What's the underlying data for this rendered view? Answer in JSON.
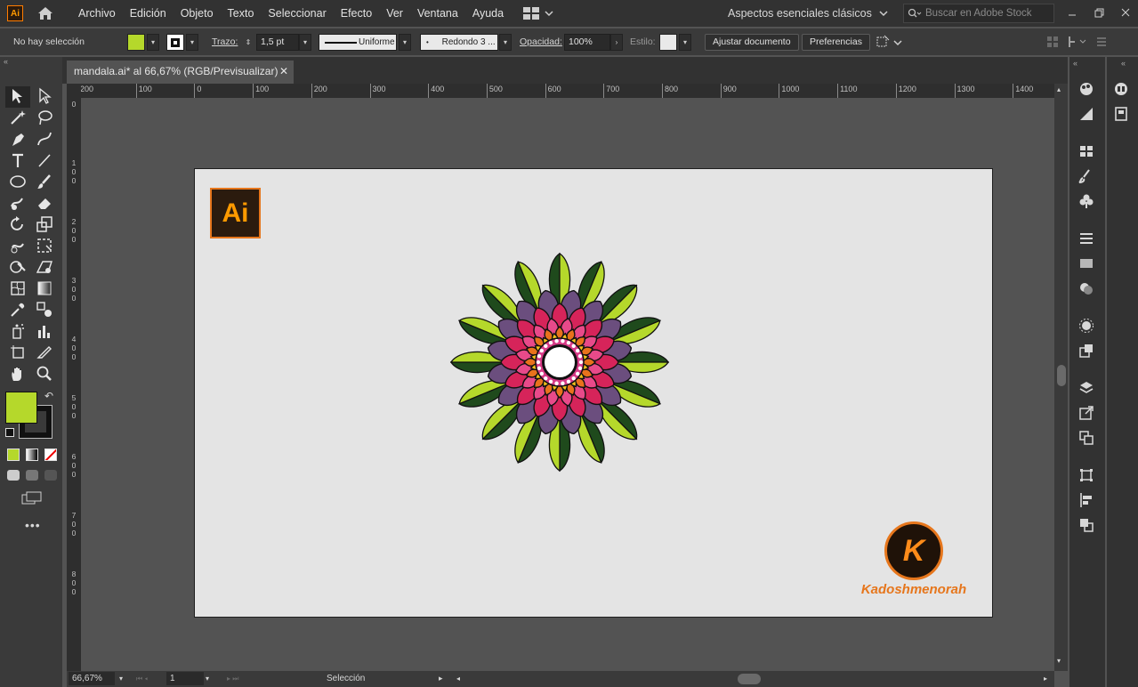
{
  "app": {
    "badge": "Ai"
  },
  "menu": [
    "Archivo",
    "Edición",
    "Objeto",
    "Texto",
    "Seleccionar",
    "Efecto",
    "Ver",
    "Ventana",
    "Ayuda"
  ],
  "workspace": {
    "label": "Aspectos esenciales clásicos"
  },
  "stock_search": {
    "placeholder": "Buscar en Adobe Stock"
  },
  "control": {
    "selection": "No hay selección",
    "fill_color": "#b5d82b",
    "stroke_label": "Trazo:",
    "stroke_weight": "1,5 pt",
    "profile": "Uniforme",
    "brush": "Redondo 3 ...",
    "opacity_label": "Opacidad:",
    "opacity": "100%",
    "style_label": "Estilo:",
    "fit_button": "Ajustar documento",
    "prefs_button": "Preferencias"
  },
  "document": {
    "tab_title": "mandala.ai* al 66,67% (RGB/Previsualizar)",
    "close": "✕"
  },
  "ruler_top": [
    "200",
    "100",
    "0",
    "100",
    "200",
    "300",
    "400",
    "500",
    "600",
    "700",
    "800",
    "900",
    "1000",
    "1100",
    "1200",
    "1300",
    "1400"
  ],
  "ruler_left": [
    "0",
    "1\n0\n0",
    "2\n0\n0",
    "3\n0\n0",
    "4\n0\n0",
    "5\n0\n0",
    "6\n0\n0",
    "7\n0\n0",
    "8\n0\n0"
  ],
  "artboard": {
    "logo_text": "Ai",
    "brand_letter": "K",
    "brand_name": "Kadoshmenorah"
  },
  "status": {
    "zoom": "66,67%",
    "page": "1",
    "tool": "Selección"
  },
  "colors": {
    "accent": "#e6761c",
    "leaf_light": "#b5d82b",
    "leaf_dark": "#1f4a1c",
    "petal_purple": "#6b4e7e",
    "petal_pink": "#d6245a",
    "petal_orange": "#e8721c",
    "petal_yellow": "#f2c21a"
  },
  "tool_icons": [
    "selection-icon",
    "direct-selection-icon",
    "magic-wand-icon",
    "lasso-icon",
    "pen-icon",
    "curvature-icon",
    "type-icon",
    "line-icon",
    "ellipse-icon",
    "paintbrush-icon",
    "shaper-icon",
    "eraser-icon",
    "rotate-icon",
    "scale-icon",
    "warp-icon",
    "free-transform-icon",
    "shape-builder-icon",
    "perspective-icon",
    "mesh-icon",
    "gradient-icon",
    "eyedropper-icon",
    "blend-icon",
    "symbol-sprayer-icon",
    "graph-icon",
    "artboard-icon",
    "slice-icon",
    "hand-icon",
    "zoom-icon"
  ]
}
